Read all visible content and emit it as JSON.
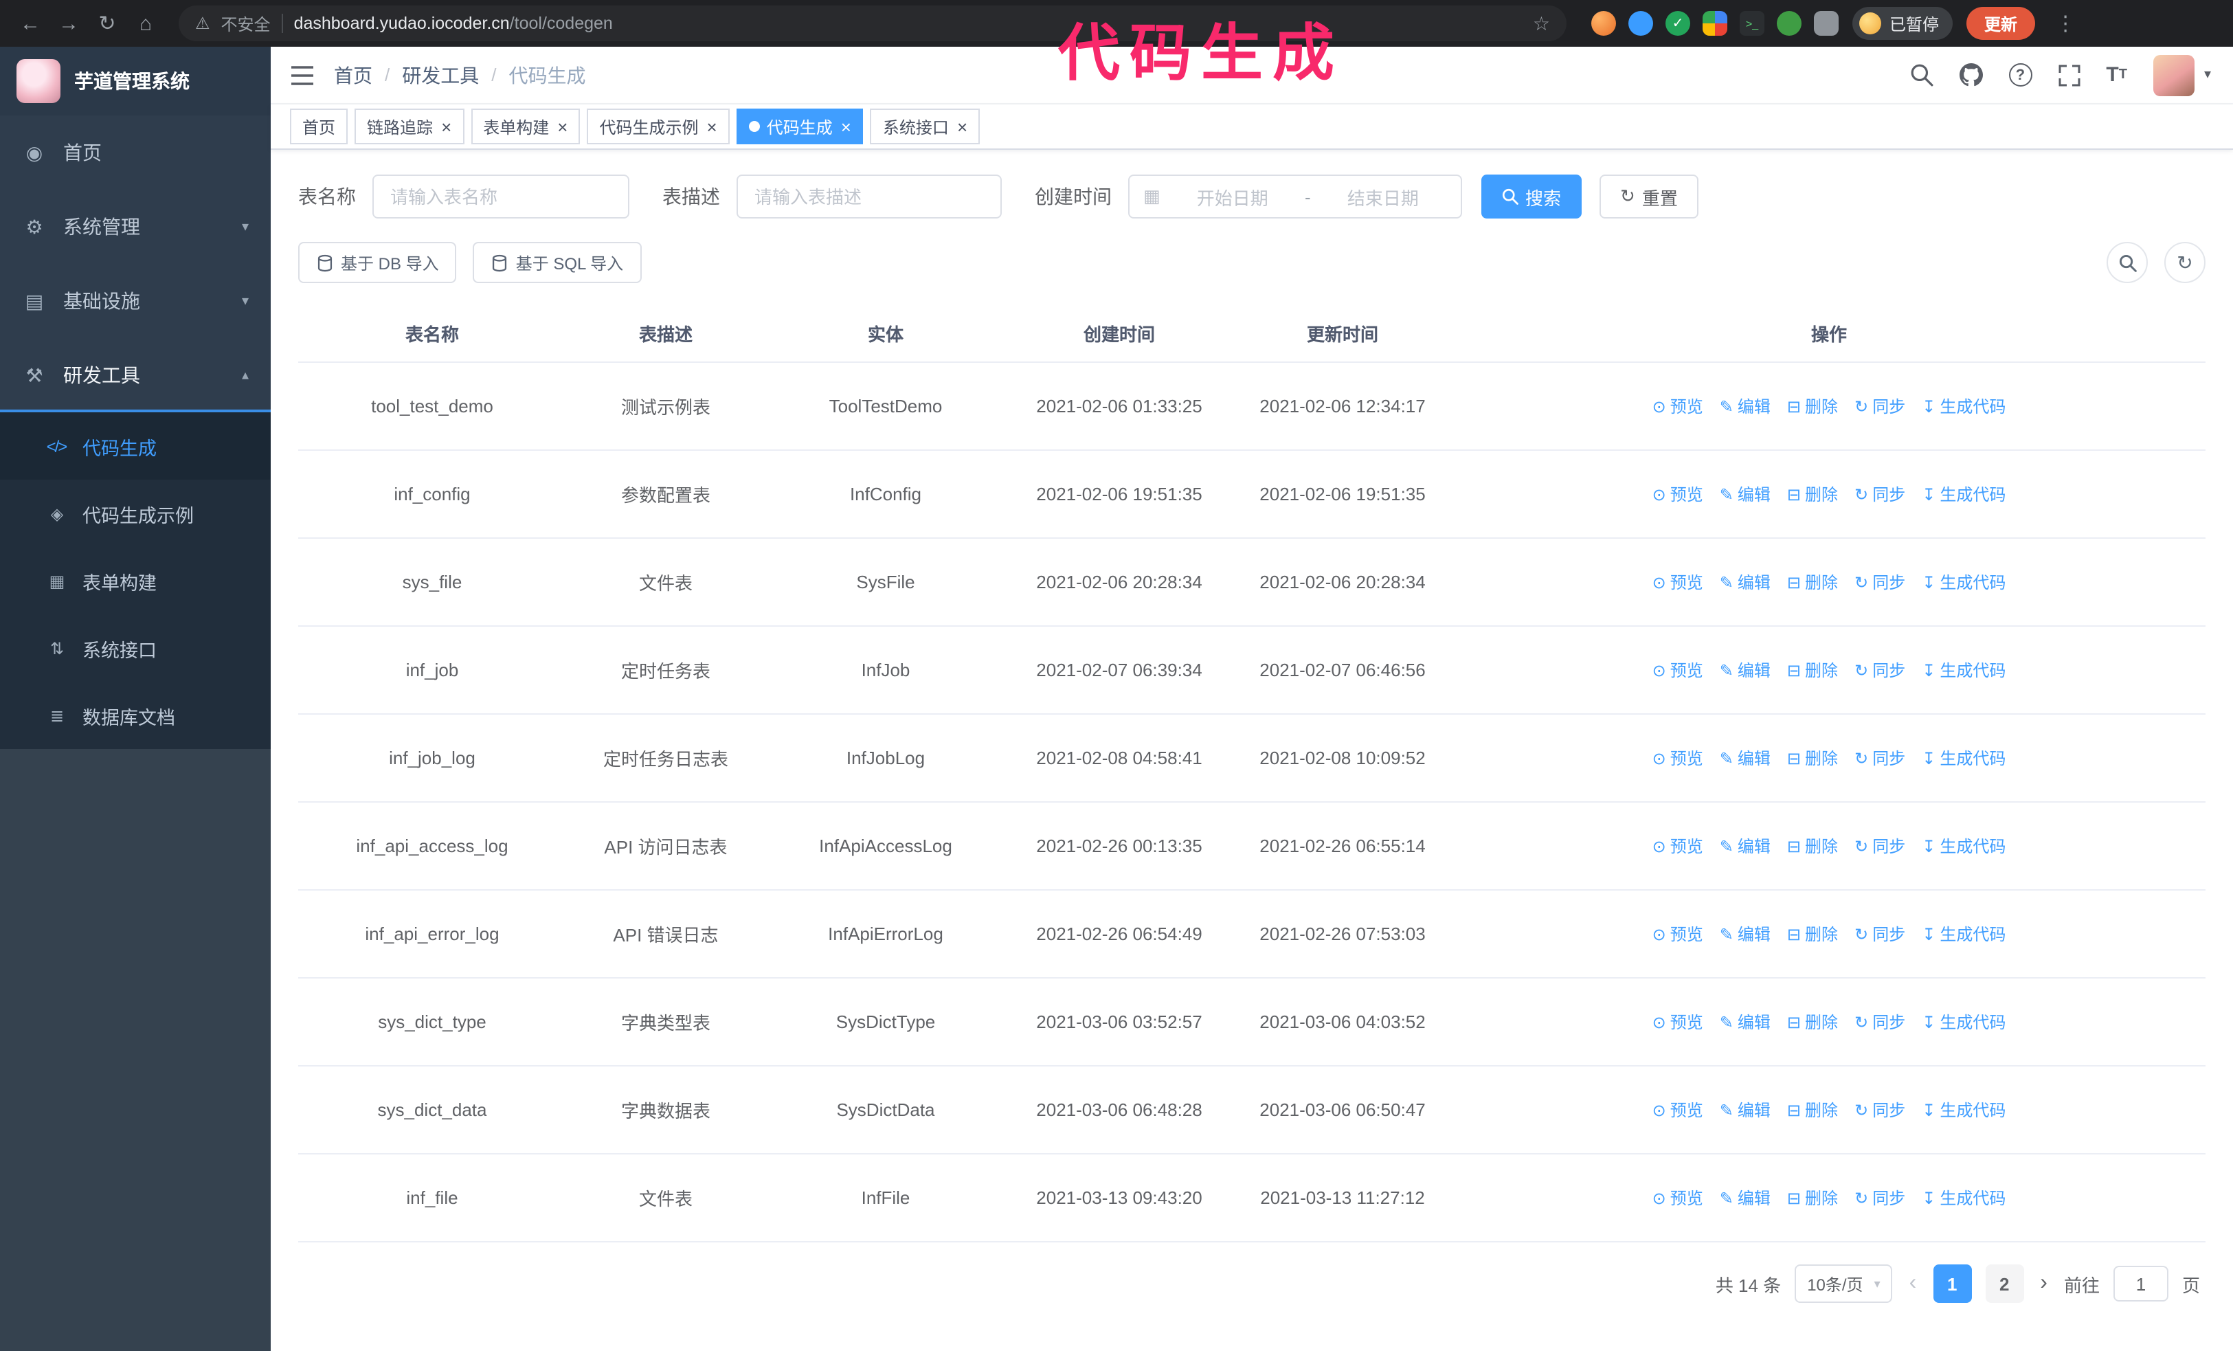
{
  "colors": {
    "accent": "#409eff",
    "annotation": "#f8296b",
    "sidebar": "#2f3d4d",
    "submenu": "#212e3c",
    "update_button": "#e2573b"
  },
  "annotation": {
    "text": "代码生成"
  },
  "browser": {
    "security_label": "不安全",
    "url_host": "dashboard.yudao.iocoder.cn",
    "url_path": "/tool/codegen",
    "paused_badge": "已暂停",
    "update_button": "更新",
    "extensions": [
      {
        "name": "fox-extension-icon"
      },
      {
        "name": "drop-extension-icon"
      },
      {
        "name": "check-extension-icon"
      },
      {
        "name": "people-extension-icon"
      },
      {
        "name": "terminal-extension-icon"
      },
      {
        "name": "leaf-extension-icon"
      },
      {
        "name": "puzzle-extension-icon"
      }
    ]
  },
  "sidebar": {
    "app_title": "芋道管理系统",
    "items": [
      {
        "id": "home",
        "label": "首页",
        "icon": "dashboard-icon"
      },
      {
        "id": "system",
        "label": "系统管理",
        "icon": "settings-icon",
        "chevron": "down"
      },
      {
        "id": "infra",
        "label": "基础设施",
        "icon": "infra-icon",
        "chevron": "down"
      },
      {
        "id": "devtools",
        "label": "研发工具",
        "icon": "tools-icon",
        "chevron": "up",
        "expanded": true
      }
    ],
    "submenu": [
      {
        "id": "codegen",
        "label": "代码生成",
        "icon": "code-icon",
        "active": true
      },
      {
        "id": "codegen-example",
        "label": "代码生成示例",
        "icon": "example-icon"
      },
      {
        "id": "form-builder",
        "label": "表单构建",
        "icon": "form-icon"
      },
      {
        "id": "system-api",
        "label": "系统接口",
        "icon": "api-icon"
      },
      {
        "id": "db-doc",
        "label": "数据库文档",
        "icon": "database-icon"
      }
    ]
  },
  "header": {
    "breadcrumb": [
      "首页",
      "研发工具",
      "代码生成"
    ]
  },
  "tabs": [
    {
      "id": "home",
      "label": "首页",
      "closable": false
    },
    {
      "id": "trace",
      "label": "链路追踪",
      "closable": true
    },
    {
      "id": "form-builder",
      "label": "表单构建",
      "closable": true
    },
    {
      "id": "codegen-example",
      "label": "代码生成示例",
      "closable": true
    },
    {
      "id": "codegen",
      "label": "代码生成",
      "closable": true,
      "active": true
    },
    {
      "id": "system-api",
      "label": "系统接口",
      "closable": true
    }
  ],
  "filters": {
    "table_name_label": "表名称",
    "table_name_placeholder": "请输入表名称",
    "table_desc_label": "表描述",
    "table_desc_placeholder": "请输入表描述",
    "create_time_label": "创建时间",
    "date_start_placeholder": "开始日期",
    "date_separator": "-",
    "date_end_placeholder": "结束日期",
    "search_button": "搜索",
    "reset_button": "重置"
  },
  "toolbar": {
    "import_db": "基于 DB 导入",
    "import_sql": "基于 SQL 导入"
  },
  "table": {
    "columns": [
      "表名称",
      "表描述",
      "实体",
      "创建时间",
      "更新时间",
      "操作"
    ],
    "actions": [
      "预览",
      "编辑",
      "删除",
      "同步",
      "生成代码"
    ],
    "rows": [
      {
        "name": "tool_test_demo",
        "desc": "测试示例表",
        "entity": "ToolTestDemo",
        "created": "2021-02-06 01:33:25",
        "updated": "2021-02-06 12:34:17"
      },
      {
        "name": "inf_config",
        "desc": "参数配置表",
        "entity": "InfConfig",
        "created": "2021-02-06 19:51:35",
        "updated": "2021-02-06 19:51:35"
      },
      {
        "name": "sys_file",
        "desc": "文件表",
        "entity": "SysFile",
        "created": "2021-02-06 20:28:34",
        "updated": "2021-02-06 20:28:34"
      },
      {
        "name": "inf_job",
        "desc": "定时任务表",
        "entity": "InfJob",
        "created": "2021-02-07 06:39:34",
        "updated": "2021-02-07 06:46:56"
      },
      {
        "name": "inf_job_log",
        "desc": "定时任务日志表",
        "entity": "InfJobLog",
        "created": "2021-02-08 04:58:41",
        "updated": "2021-02-08 10:09:52"
      },
      {
        "name": "inf_api_access_log",
        "desc": "API 访问日志表",
        "entity": "InfApiAccessLog",
        "created": "2021-02-26 00:13:35",
        "updated": "2021-02-26 06:55:14"
      },
      {
        "name": "inf_api_error_log",
        "desc": "API 错误日志",
        "entity": "InfApiErrorLog",
        "created": "2021-02-26 06:54:49",
        "updated": "2021-02-26 07:53:03"
      },
      {
        "name": "sys_dict_type",
        "desc": "字典类型表",
        "entity": "SysDictType",
        "created": "2021-03-06 03:52:57",
        "updated": "2021-03-06 04:03:52"
      },
      {
        "name": "sys_dict_data",
        "desc": "字典数据表",
        "entity": "SysDictData",
        "created": "2021-03-06 06:48:28",
        "updated": "2021-03-06 06:50:47"
      },
      {
        "name": "inf_file",
        "desc": "文件表",
        "entity": "InfFile",
        "created": "2021-03-13 09:43:20",
        "updated": "2021-03-13 11:27:12"
      }
    ]
  },
  "pagination": {
    "total_text": "共 14 条",
    "page_size": "10条/页",
    "pages": [
      "1",
      "2"
    ],
    "current_page": "1",
    "goto_prefix": "前往",
    "goto_value": "1",
    "goto_suffix": "页"
  }
}
